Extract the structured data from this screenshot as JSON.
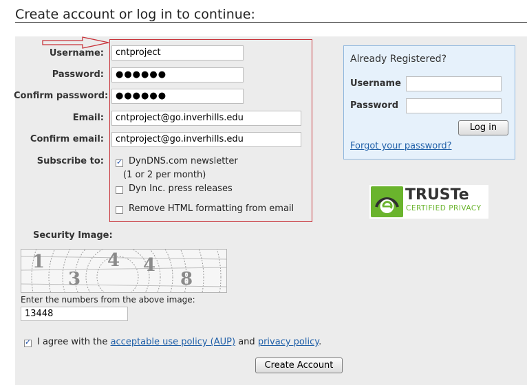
{
  "heading": "Create account or log in to continue:",
  "form": {
    "username_label": "Username:",
    "username_value": "cntproject",
    "password_label": "Password:",
    "password_value": "●●●●●●",
    "confirm_password_label": "Confirm password:",
    "confirm_password_value": "●●●●●●",
    "email_label": "Email:",
    "email_value": "cntproject@go.inverhills.edu",
    "confirm_email_label": "Confirm email:",
    "confirm_email_value": "cntproject@go.inverhills.edu",
    "subscribe_label": "Subscribe to:",
    "options": [
      {
        "label": "DynDNS.com newsletter",
        "sublabel": "(1 or 2 per month)",
        "checked": true
      },
      {
        "label": "Dyn Inc. press releases",
        "checked": false
      },
      {
        "label": "Remove HTML formatting from email",
        "checked": false
      }
    ]
  },
  "login": {
    "title": "Already Registered?",
    "username_label": "Username",
    "password_label": "Password",
    "username_value": "",
    "password_value": "",
    "login_button": "Log in",
    "forgot_link": "Forgot your password?"
  },
  "badge": {
    "truste_title": "TRUSTe",
    "truste_subtitle": "CERTIFIED PRIVACY"
  },
  "security": {
    "label": "Security Image:",
    "captcha_digits": [
      "1",
      "3",
      "4",
      "4",
      "8"
    ],
    "instruction": "Enter the numbers from the above image:",
    "entered_value": "13448"
  },
  "agreement": {
    "prefix": "I agree with the",
    "aup_link": "acceptable use policy (AUP)",
    "middle": "and",
    "privacy_link": "privacy policy",
    "suffix": ".",
    "checked": true
  },
  "create_button": "Create Account",
  "colors": {
    "panel_bg": "#ececec",
    "highlight_border": "#c8333a",
    "login_box_bg": "#e6f1fb",
    "link": "#1f5fa8",
    "truste_green": "#6ab42d"
  }
}
